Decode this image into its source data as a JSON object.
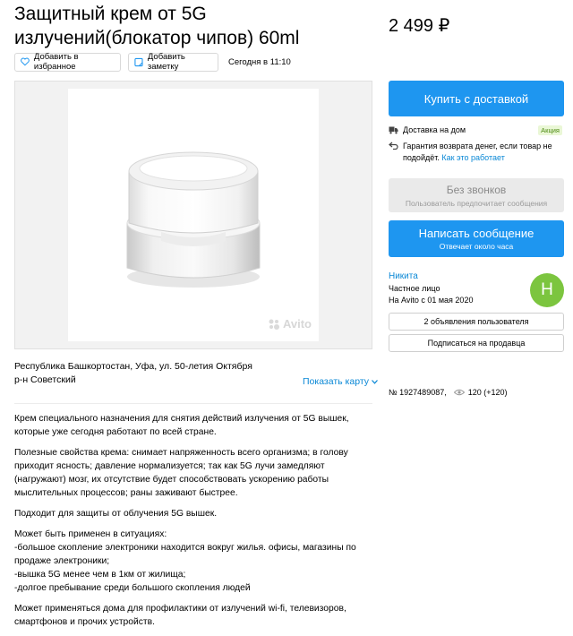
{
  "listing": {
    "title": "Защитный крем от 5G излучений(блокатор чипов) 60ml",
    "price": "2 499 ₽",
    "favorite_label": "Добавить в избранное",
    "note_label": "Добавить заметку",
    "date": "Сегодня в 11:10",
    "watermark": "Avito",
    "address_line1": "Республика Башкортостан, Уфа, ул. 50-летия Октября",
    "address_line2": "р-н Советский",
    "map_link": "Показать карту",
    "description": [
      "Крем специального назначения для снятия действий излучения от 5G вышек, которые уже сегодня работают по всей стране.",
      "Полезные свойства крема: снимает напряженность всего организма; в голову приходит ясность; давление нормализуется; так как 5G лучи замедляют (нагружают) мозг, их отсутствие будет способствовать ускорению работы мыслительных процессов; раны заживают быстрее.",
      "Подходит для защиты от облучения 5G вышек.",
      "Может быть применен в ситуациях:\n-большое скопление электроники находится вокруг жилья. офисы, магазины по продаже электроники;\n-вышка 5G менее чем в 1км от жилища;\n-долгое пребывание среди большого скопления людей",
      "Может применяться дома для профилактики от излучений wi-fi, телевизоров, смартфонов и прочих устройств."
    ]
  },
  "sidebar": {
    "buy_label": "Купить с доставкой",
    "delivery_label": "Доставка на дом",
    "promo_badge": "Акция",
    "guarantee_text": "Гарантия возврата денег, если товар не подойдёт.",
    "guarantee_link": "Как это работает",
    "nocall_title": "Без звонков",
    "nocall_sub": "Пользователь предпочитает сообщения",
    "message_title": "Написать сообщение",
    "message_sub": "Отвечает около часа",
    "seller_name": "Никита",
    "seller_type": "Частное лицо",
    "seller_since": "На Avito с 01 мая 2020",
    "avatar_letter": "Н",
    "ads_button": "2 объявления пользователя",
    "subscribe_button": "Подписаться на продавца",
    "listing_number": "№ 1927489087,",
    "views": "120 (+120)"
  },
  "colors": {
    "accent": "#1e96f0",
    "link": "#0a88d6",
    "avatar": "#7cc53f"
  }
}
